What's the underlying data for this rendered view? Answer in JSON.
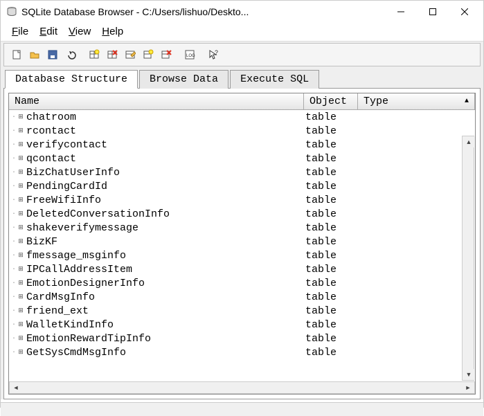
{
  "window": {
    "title": "SQLite Database Browser - C:/Users/lishuo/Deskto..."
  },
  "menu": {
    "file": "File",
    "edit": "Edit",
    "view": "View",
    "help": "Help"
  },
  "tabs": {
    "structure": "Database Structure",
    "browse": "Browse Data",
    "sql": "Execute SQL"
  },
  "columns": {
    "name": "Name",
    "object": "Object",
    "type": "Type"
  },
  "rows": [
    {
      "name": "chatroom",
      "object": "table",
      "type": ""
    },
    {
      "name": "rcontact",
      "object": "table",
      "type": ""
    },
    {
      "name": "verifycontact",
      "object": "table",
      "type": ""
    },
    {
      "name": "qcontact",
      "object": "table",
      "type": ""
    },
    {
      "name": "BizChatUserInfo",
      "object": "table",
      "type": ""
    },
    {
      "name": "PendingCardId",
      "object": "table",
      "type": ""
    },
    {
      "name": "FreeWifiInfo",
      "object": "table",
      "type": ""
    },
    {
      "name": "DeletedConversationInfo",
      "object": "table",
      "type": ""
    },
    {
      "name": "shakeverifymessage",
      "object": "table",
      "type": ""
    },
    {
      "name": "BizKF",
      "object": "table",
      "type": ""
    },
    {
      "name": "fmessage_msginfo",
      "object": "table",
      "type": ""
    },
    {
      "name": "IPCallAddressItem",
      "object": "table",
      "type": ""
    },
    {
      "name": "EmotionDesignerInfo",
      "object": "table",
      "type": ""
    },
    {
      "name": "CardMsgInfo",
      "object": "table",
      "type": ""
    },
    {
      "name": "friend_ext",
      "object": "table",
      "type": ""
    },
    {
      "name": "WalletKindInfo",
      "object": "table",
      "type": ""
    },
    {
      "name": "EmotionRewardTipInfo",
      "object": "table",
      "type": ""
    },
    {
      "name": "GetSysCmdMsgInfo",
      "object": "table",
      "type": ""
    }
  ]
}
